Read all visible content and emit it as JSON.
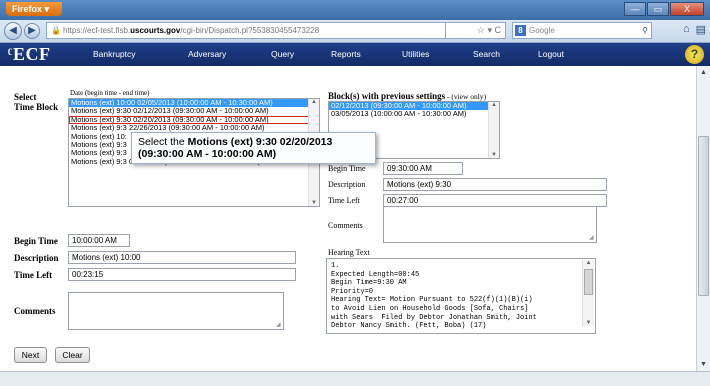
{
  "browser": {
    "app_button": "Firefox",
    "url_prefix": "https://ecf-test.flsb.",
    "url_domain": "uscourts.gov",
    "url_path": "/cgi-bin/Dispatch.pl?553830455473228",
    "search_placeholder": "Google",
    "win_min": "—",
    "win_max": "▭",
    "win_close": "X"
  },
  "ecf": {
    "logo": "ECF",
    "menu": [
      "Bankruptcy",
      "Adversary",
      "Query",
      "Reports",
      "Utilities",
      "Search",
      "Logout"
    ],
    "help": "?"
  },
  "form": {
    "select_label": "Select",
    "time_block_label": "Time Block",
    "date_hint": "Date (begin time - end time)",
    "time_blocks": [
      "Motions (ext) 10:00 02/05/2013 (10:00:00 AM - 10:30:00 AM)",
      "Motions (ext) 9:30 02/12/2013 (09:30:00 AM - 10:00:00 AM)",
      "Motions (ext) 9:30 02/20/2013 (09:30:00 AM - 10:00:00 AM)",
      "Motions (ext) 9:3   22/26/2013 (09:30:00 AM - 10:00:00 AM)",
      "Motions (ext) 10:",
      "Motions (ext) 9:3",
      "Motions (ext) 9:3",
      "Motions (ext) 9:3  0/30/2013 (09:30:00 AM - 10:00:00 AM)"
    ],
    "begin_time_label": "Begin Time",
    "begin_time_value": "10:00:00 AM",
    "description_label": "Description",
    "description_value": "Motions (ext) 10:00",
    "time_left_label": "Time Left",
    "time_left_value": "00:23:15",
    "comments_label": "Comments",
    "comments_value": ""
  },
  "previous": {
    "heading": "Block(s) with previous settings",
    "view_only": " - (view only)",
    "blocks": [
      "02/12/2013 (09:30:00 AM - 10:00:00 AM)",
      "03/05/2013 (10:00:00 AM - 10:30:00 AM)"
    ],
    "begin_time_label": "Begin Time",
    "begin_time_value": "09:30:00 AM",
    "description_label": "Description",
    "description_value": "Motions (ext) 9:30",
    "time_left_label": "Time Left",
    "time_left_value": "00:27:00",
    "comments_label": "Comments",
    "hearing_text_label": "Hearing Text",
    "hearing_text": "1.\nExpected Length=00:45\nBegin Time=9:30 AM\nPriority=0\nHearing Text= Motion Pursuant to 522(f)(1)(B)(i)\nto Avoid Lien on Household Goods [Sofa, Chairs]\nwith Sears  Filed by Debtor Jonathan Smith, Joint\nDebtor Nancy Smith. (Fett, Boba) (17)"
  },
  "tooltip": {
    "prefix": "Select the ",
    "bold": "Motions (ext) 9:30 02/20/2013 (09:30:00 AM - 10:00:00 AM)"
  },
  "buttons": {
    "next": "Next",
    "clear": "Clear"
  }
}
